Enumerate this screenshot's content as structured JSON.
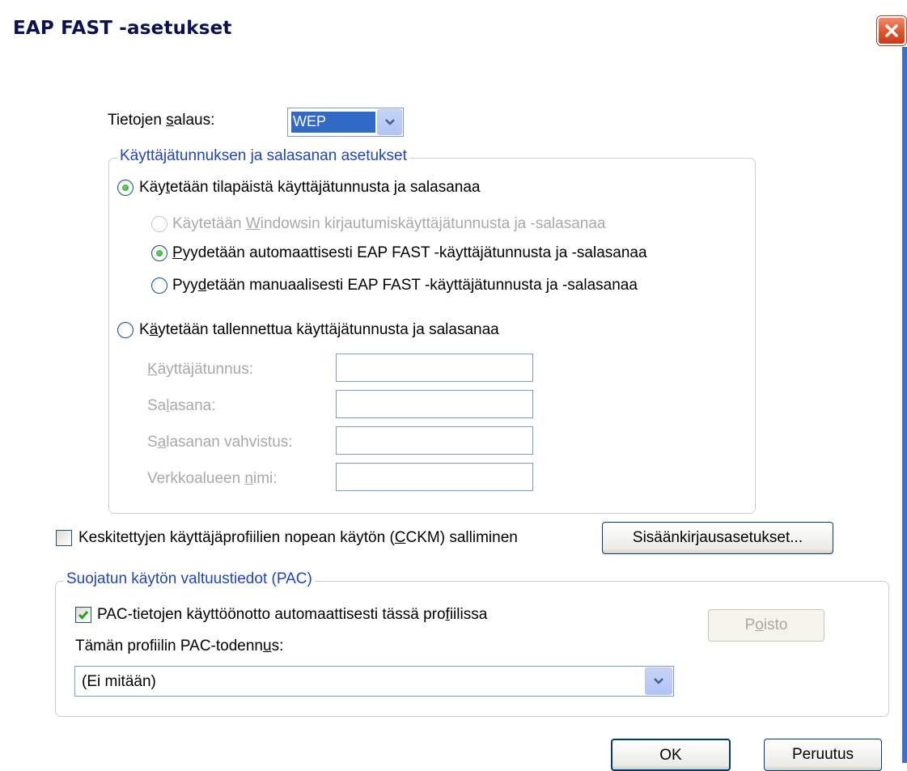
{
  "window": {
    "title": "EAP FAST -asetukset",
    "close_label": "close"
  },
  "encryption": {
    "label_before": "Tietojen ",
    "label_u": "s",
    "label_after": "alaus:",
    "value": "WEP"
  },
  "credentials_group": {
    "legend": "Käyttäjätunnuksen ja salasanan asetukset",
    "temp_option": {
      "before": "Käy",
      "u": "t",
      "after": "etään tilapäistä käyttäjätunnusta ja salasanaa"
    },
    "windows_option": {
      "before": "Käytetään ",
      "u": "W",
      "after": "indowsin kirjautumiskäyttäjätunnusta ja -salasanaa"
    },
    "auto_option": {
      "before": "",
      "u": "P",
      "after": "yydetään automaattisesti EAP FAST -käyttäjätunnusta ja -salasanaa"
    },
    "manual_option": {
      "before": "Pyy",
      "u": "d",
      "after": "etään manuaalisesti EAP FAST -käyttäjätunnusta ja -salasanaa"
    },
    "saved_option": {
      "before": "K",
      "u": "ä",
      "after": "ytetään tallennettua käyttäjätunnusta ja salasanaa"
    },
    "username": {
      "before": "",
      "u": "K",
      "after": "äyttäjätunnus:",
      "value": ""
    },
    "password": {
      "before": "Sa",
      "u": "l",
      "after": "asana:",
      "value": ""
    },
    "confirm": {
      "before": "S",
      "u": "a",
      "after": "lasanan vahvistus:",
      "value": ""
    },
    "domain": {
      "before": "Verkkoalueen ",
      "u": "n",
      "after": "imi:",
      "value": ""
    }
  },
  "cckm": {
    "before": "Keskitettyjen käyttäjäprofiilien nopean käytön (",
    "u": "C",
    "after": "CKM) salliminen"
  },
  "login_settings_button": {
    "before": "Sisäänkir",
    "u": "j",
    "after": "ausasetukset..."
  },
  "pac_group": {
    "legend": "Suojatun käytön valtuustiedot (PAC)",
    "auto_provision": {
      "before": "PAC-tietojen käyttöönotto automaattisesti tässä pro",
      "u": "f",
      "after": "iilissa"
    },
    "delete_button": {
      "before": "P",
      "u": "o",
      "after": "isto"
    },
    "auth_label": {
      "before": "Tämän profiilin PAC-todenn",
      "u": "u",
      "after": "s:"
    },
    "auth_value": "(Ei mitään)"
  },
  "buttons": {
    "ok": "OK",
    "cancel": "Peruutus"
  },
  "colors": {
    "legend": "#1f44c4",
    "disabled_text": "#a9a9a9",
    "selection": "#316ac5",
    "radio_dot": "#21a121",
    "close_button": "#e0532c"
  }
}
